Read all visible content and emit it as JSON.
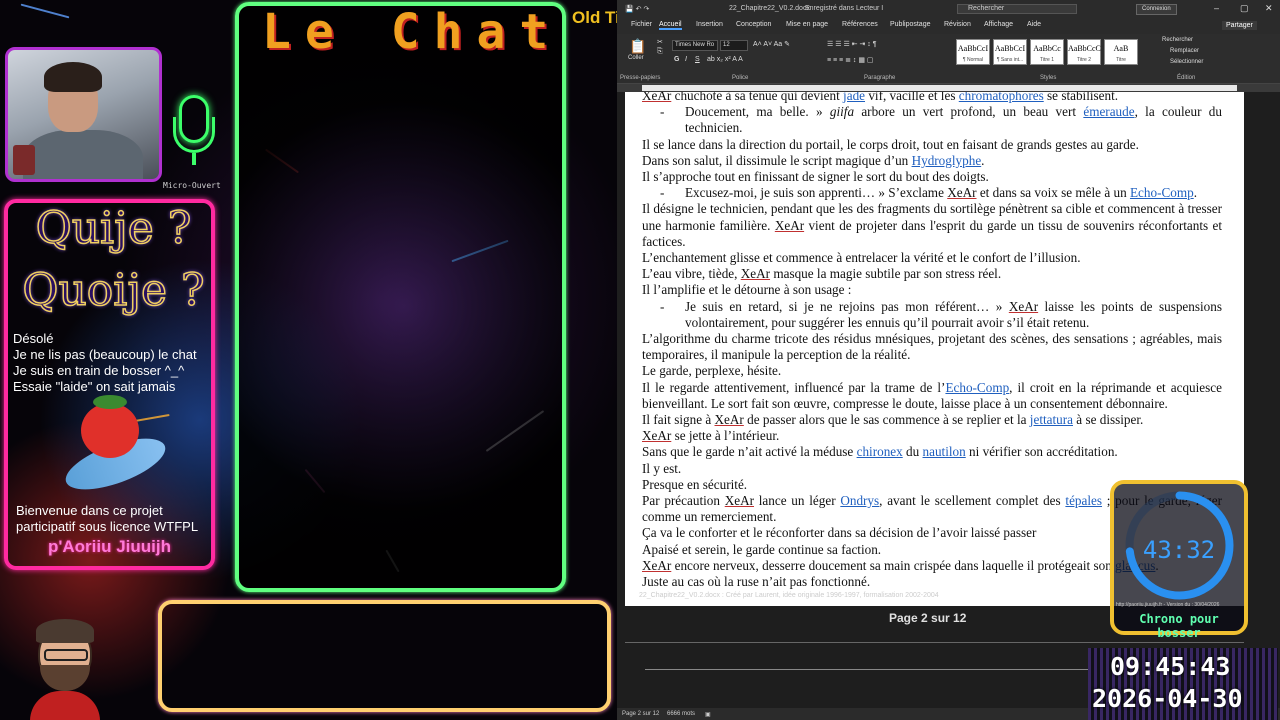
{
  "overlay": {
    "mic_label": "Micro-Ouvert",
    "quiz_line1": "Quije ?",
    "quiz_line2": "Quoije ?",
    "info_lines": [
      "Désolé",
      "Je ne lis pas (beaucoup) le chat",
      "Je suis en train de bosser ^_^",
      "Essaie \"laide\" on sait jamais"
    ],
    "welcome_lines": [
      "Bienvenue dans ce projet",
      "participatif sous licence WTFPL"
    ],
    "signature": "p'Aoriiu Jiuuijh",
    "chat_title": "Le Chat",
    "old_time": "Old Time",
    "chrono_time": "43:32",
    "chrono_label": "Chrono pour bosser",
    "chrono_url": "http://paoriiu.jiuuijh.fr - Version du : 30/04/2026",
    "chrono_progress": 0.73,
    "clock_time": "09:45:43",
    "clock_date": "2026-04-30"
  },
  "word": {
    "doc_title": "22_Chapitre22_V0.2.docx",
    "saved_status": "Enregistré dans Lecteur I",
    "search_placeholder": "Rechercher",
    "connexion_label": "Connexion",
    "tabs": [
      "Fichier",
      "Accueil",
      "Insertion",
      "Conception",
      "Mise en page",
      "Références",
      "Publipostage",
      "Révision",
      "Affichage",
      "Aide"
    ],
    "share_label": "Partager",
    "ribbon": {
      "paste": "Coller",
      "font_name": "Times New Ro",
      "font_size": "12",
      "groups": [
        "Presse-papiers",
        "Police",
        "Paragraphe",
        "Styles",
        "Édition"
      ],
      "styles": [
        {
          "preview": "AaBbCcI",
          "name": "¶ Normal"
        },
        {
          "preview": "AaBbCcI",
          "name": "¶ Sans int..."
        },
        {
          "preview": "AaBbCc",
          "name": "Titre 1"
        },
        {
          "preview": "AaBbCcC",
          "name": "Titre 2"
        },
        {
          "preview": "AaB",
          "name": "Titre"
        }
      ],
      "edit": [
        "Rechercher",
        "Remplacer",
        "Sélectionner"
      ]
    },
    "footer_meta": "22_Chapitre22_V0.2.docx : Créé par Laurent, idée originale 1996-1997, formalisation 2002-2004",
    "page_number": "Page 2 sur 12",
    "status_page": "Page 2 sur 12",
    "status_words": "6666 mots"
  }
}
